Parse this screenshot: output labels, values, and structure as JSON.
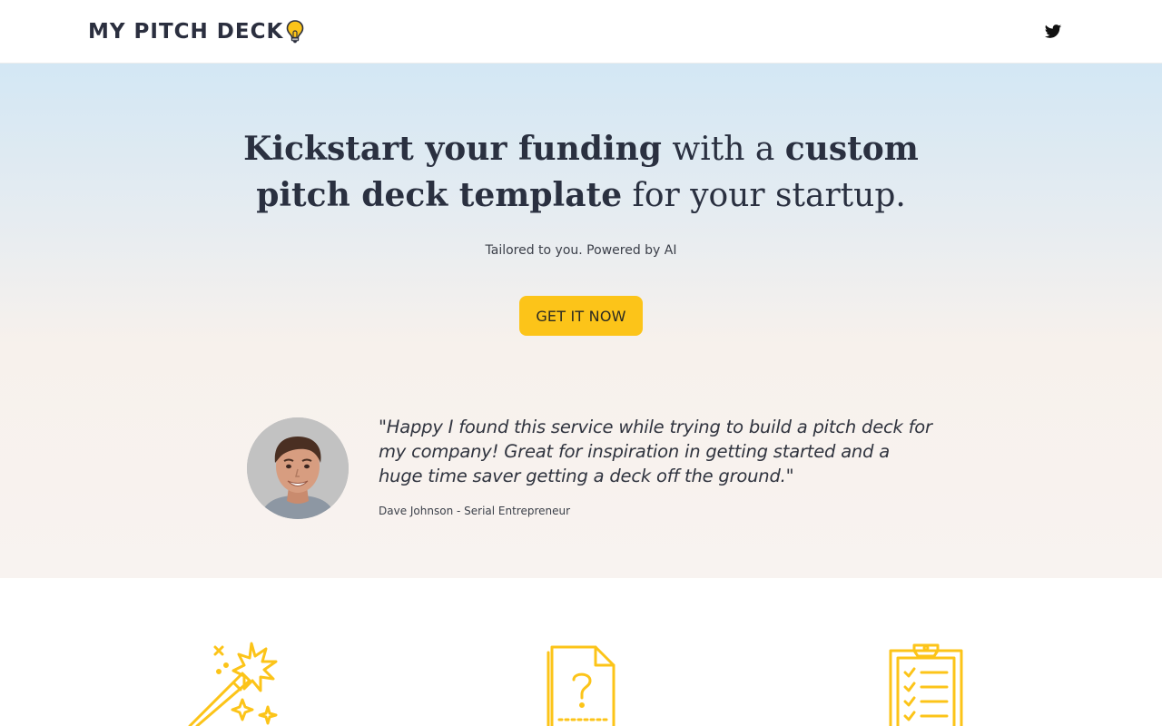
{
  "header": {
    "brand": "MY PITCH DECK",
    "brand_icon": "lightbulb-icon",
    "social_icon": "twitter-icon"
  },
  "hero": {
    "headline": {
      "part1_bold": "Kickstart your funding",
      "part2": " with a ",
      "part3_bold": "custom pitch deck template",
      "part4": " for your startup."
    },
    "subtitle": "Tailored to you. Powered by AI",
    "cta_label": "GET IT NOW"
  },
  "testimonial": {
    "quote": "\"Happy I found this service while trying to build a pitch deck for my company! Great for inspiration in getting started and a huge time saver getting a deck off the ground.\"",
    "author": "Dave Johnson - Serial Entrepreneur"
  },
  "features": {
    "icons": [
      "magic-wand-icon",
      "question-document-icon",
      "clipboard-checklist-icon"
    ]
  },
  "colors": {
    "accent": "#fcc419",
    "text_dark": "#2a3040",
    "hero_top": "#d3e7f4",
    "hero_bottom": "#f8f3f0"
  }
}
